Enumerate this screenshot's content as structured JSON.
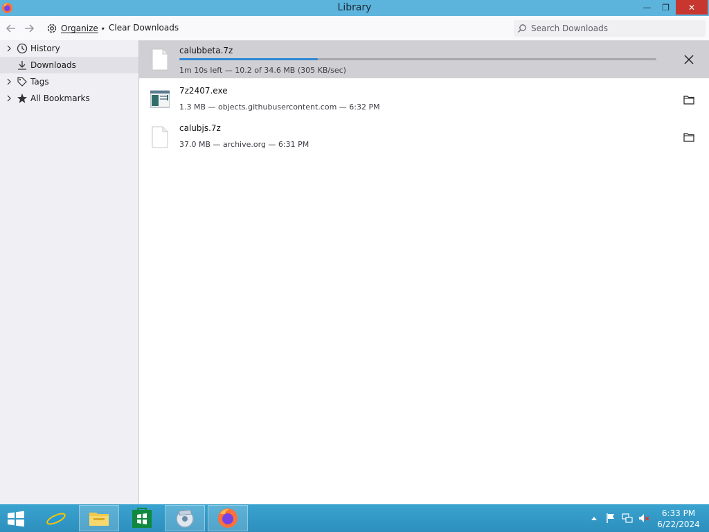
{
  "window": {
    "title": "Library",
    "minimize_glyph": "—",
    "maximize_glyph": "❐",
    "close_glyph": "✕"
  },
  "toolbar": {
    "organize_label": "Organize",
    "clear_label": "Clear Downloads",
    "search_placeholder": "Search Downloads"
  },
  "sidebar": {
    "items": [
      {
        "label": "History",
        "icon": "clock-icon",
        "expandable": true,
        "selected": false
      },
      {
        "label": "Downloads",
        "icon": "download-icon",
        "expandable": false,
        "selected": true
      },
      {
        "label": "Tags",
        "icon": "tag-icon",
        "expandable": true,
        "selected": false
      },
      {
        "label": "All Bookmarks",
        "icon": "star-icon",
        "expandable": true,
        "selected": false
      }
    ]
  },
  "downloads": [
    {
      "name": "calubbeta.7z",
      "status": "1m 10s left — 10.2 of 34.6 MB (305 KB/sec)",
      "in_progress": true,
      "progress": 0.29,
      "action": "cancel-icon"
    },
    {
      "name": "7z2407.exe",
      "status": "1.3 MB — objects.githubusercontent.com — 6:32 PM",
      "in_progress": false,
      "action": "folder-icon"
    },
    {
      "name": "calubjs.7z",
      "status": "37.0 MB — archive.org — 6:31 PM",
      "in_progress": false,
      "action": "folder-icon"
    }
  ],
  "colors": {
    "titlebar": "#5cb3dc",
    "close_button": "#c7372f",
    "progress": "#2f86d6",
    "taskbar": "#3aa3cf"
  },
  "taskbar": {
    "apps": [
      "windows-start-icon",
      "internet-explorer-icon",
      "file-explorer-icon",
      "store-icon",
      "media-icon",
      "firefox-icon"
    ],
    "tray": [
      "show-hidden-icons",
      "flag-icon",
      "network-icon",
      "volume-muted-icon"
    ],
    "time": "6:33 PM",
    "date": "6/22/2024"
  }
}
